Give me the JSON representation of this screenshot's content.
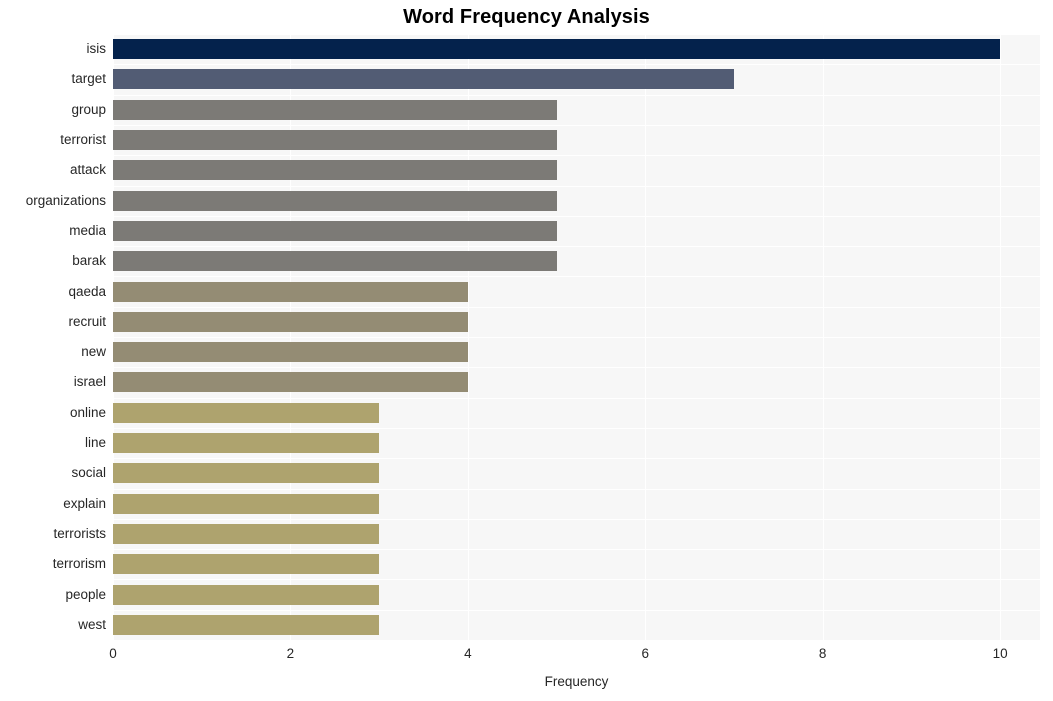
{
  "chart_data": {
    "type": "bar",
    "orientation": "horizontal",
    "title": "Word Frequency Analysis",
    "xlabel": "Frequency",
    "ylabel": "",
    "xlim": [
      0,
      10.45
    ],
    "ylim": [
      0,
      20
    ],
    "grid": true,
    "legend": null,
    "xticks": [
      "0",
      "2",
      "4",
      "6",
      "8",
      "10"
    ],
    "xtick_values": [
      0,
      2,
      4,
      6,
      8,
      10
    ],
    "categories": [
      "isis",
      "target",
      "group",
      "terrorist",
      "attack",
      "organizations",
      "media",
      "barak",
      "qaeda",
      "recruit",
      "new",
      "israel",
      "online",
      "line",
      "social",
      "explain",
      "terrorists",
      "terrorism",
      "people",
      "west"
    ],
    "values": [
      10,
      7,
      5,
      5,
      5,
      5,
      5,
      5,
      4,
      4,
      4,
      4,
      3,
      3,
      3,
      3,
      3,
      3,
      3,
      3
    ],
    "bar_colors": [
      "#04224c",
      "#525c74",
      "#7c7a76",
      "#7c7a76",
      "#7c7a76",
      "#7c7a76",
      "#7c7a76",
      "#7c7a76",
      "#948c74",
      "#948c74",
      "#948c74",
      "#948c74",
      "#aea36e",
      "#aea36e",
      "#aea36e",
      "#aea36e",
      "#aea36e",
      "#aea36e",
      "#aea36e",
      "#aea36e"
    ]
  },
  "style": {
    "figure_background": "#ffffff",
    "plot_background": "#f7f7f7",
    "grid_color": "#ffffff",
    "text_color": "#262626",
    "title_color": "#000000"
  }
}
